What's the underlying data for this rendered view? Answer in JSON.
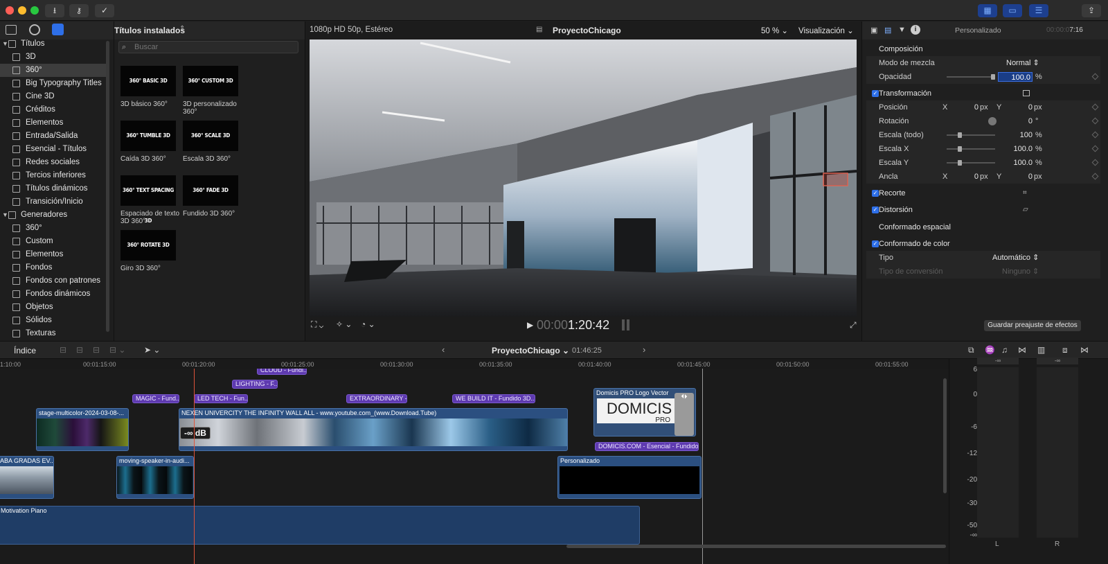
{
  "toolbar": {
    "import_icon": "download-arrow",
    "keywords_icon": "key",
    "background_tasks_icon": "check-circle",
    "share_icon": "share"
  },
  "sidebar": {
    "items": [
      {
        "label": "Títulos",
        "level": 0,
        "expanded": true
      },
      {
        "label": "3D",
        "level": 1
      },
      {
        "label": "360°",
        "level": 1,
        "selected": true
      },
      {
        "label": "Big Typography Titles",
        "level": 1
      },
      {
        "label": "Cine 3D",
        "level": 1
      },
      {
        "label": "Créditos",
        "level": 1
      },
      {
        "label": "Elementos",
        "level": 1
      },
      {
        "label": "Entrada/Salida",
        "level": 1
      },
      {
        "label": "Esencial - Títulos",
        "level": 1
      },
      {
        "label": "Redes sociales",
        "level": 1
      },
      {
        "label": "Tercios inferiores",
        "level": 1
      },
      {
        "label": "Títulos dinámicos",
        "level": 1
      },
      {
        "label": "Transición/Inicio",
        "level": 1
      },
      {
        "label": "Generadores",
        "level": 0,
        "expanded": true
      },
      {
        "label": "360°",
        "level": 1
      },
      {
        "label": "Custom",
        "level": 1
      },
      {
        "label": "Elementos",
        "level": 1
      },
      {
        "label": "Fondos",
        "level": 1
      },
      {
        "label": "Fondos con patrones",
        "level": 1
      },
      {
        "label": "Fondos dinámicos",
        "level": 1
      },
      {
        "label": "Objetos",
        "level": 1
      },
      {
        "label": "Sólidos",
        "level": 1
      },
      {
        "label": "Texturas",
        "level": 1
      }
    ]
  },
  "browser": {
    "title": "Títulos instalados",
    "search_placeholder": "Buscar",
    "items": [
      {
        "thumb": "360° BASIC 3D",
        "label": "3D básico 360°"
      },
      {
        "thumb": "360° CUSTOM 3D",
        "label": "3D personalizado 360°"
      },
      {
        "thumb": "360° TUMBLE 3D",
        "label": "Caída 3D 360°"
      },
      {
        "thumb": "360° SCALE 3D",
        "label": "Escala 3D 360°"
      },
      {
        "thumb": "360° TEXT SPACING 3D",
        "label": "Espaciado de texto 3D 360°"
      },
      {
        "thumb": "360° FADE 3D",
        "label": "Fundido 3D 360°"
      },
      {
        "thumb": "360° ROTATE 3D",
        "label": "Giro 3D 360°"
      }
    ]
  },
  "viewer": {
    "format": "1080p HD 50p, Estéreo",
    "project": "ProyectoChicago",
    "zoom": "50 %",
    "view_menu": "Visualización",
    "timecode_dim": "00:00",
    "timecode": "1:20:42"
  },
  "inspector": {
    "header": "Personalizado",
    "timecode_dim": "00:00:0",
    "timecode": "7:16",
    "sections": {
      "composition": "Composición",
      "blend_mode_label": "Modo de mezcla",
      "blend_mode_value": "Normal",
      "opacity_label": "Opacidad",
      "opacity_value": "100.0",
      "opacity_unit": "%",
      "transform": "Transformación",
      "position_label": "Posición",
      "position_x": "0",
      "position_y": "0",
      "rotation_label": "Rotación",
      "rotation_value": "0",
      "rotation_unit": "°",
      "scale_all_label": "Escala (todo)",
      "scale_all_value": "100",
      "scale_x_label": "Escala X",
      "scale_x_value": "100.0",
      "scale_y_label": "Escala Y",
      "scale_y_value": "100.0",
      "anchor_label": "Ancla",
      "anchor_x": "0",
      "anchor_y": "0",
      "crop": "Recorte",
      "distort": "Distorsión",
      "spatial_conform": "Conformado espacial",
      "color_conform": "Conformado de color",
      "type_label": "Tipo",
      "type_value": "Automático",
      "conversion_label": "Tipo de conversión",
      "conversion_value": "Ninguno",
      "x": "X",
      "y": "Y",
      "px": "px",
      "pct": "%"
    },
    "save_preset": "Guardar preajuste de efectos"
  },
  "timeline": {
    "index_label": "Índice",
    "project": "ProyectoChicago",
    "duration": "01:46:25",
    "ticks": [
      "1:10:00",
      "00:01:15:00",
      "00:01:20:00",
      "00:01:25:00",
      "00:01:30:00",
      "00:01:35:00",
      "00:01:40:00",
      "00:01:45:00",
      "00:01:50:00",
      "00:01:55:00"
    ],
    "title_clips": [
      "CLOUD - Fundi...",
      "LIGHTING - F...",
      "MAGIC - Fund...",
      "LED TECH - Fun...",
      "EXTRAORDINARY -...",
      "WE BUILD IT - Fundido 3D...",
      "DOMICIS.COM - Esencial - Fundido"
    ],
    "video_clips": [
      "stage-multicolor-2024-03-08-...",
      "NEXEN UNIVERCITY THE INFINITY WALL ALL - www.youtube.com_(www.Download.Tube)",
      "Domicis PRO Logo Vector",
      "ABA GRADAS EV...",
      "moving-speaker-in-audi...",
      "Personalizado"
    ],
    "audio_clip": "Motivation Piano",
    "volume_badge": "-∞ dB",
    "logo_text": "DOMICIS",
    "logo_sub": "PRO"
  },
  "meters": {
    "scale": [
      "6",
      "0",
      "-6",
      "-12",
      "-20",
      "-30",
      "-50",
      "-∞"
    ],
    "peak_left": "-∞",
    "peak_right": "-∞",
    "channels": [
      "L",
      "R"
    ]
  }
}
